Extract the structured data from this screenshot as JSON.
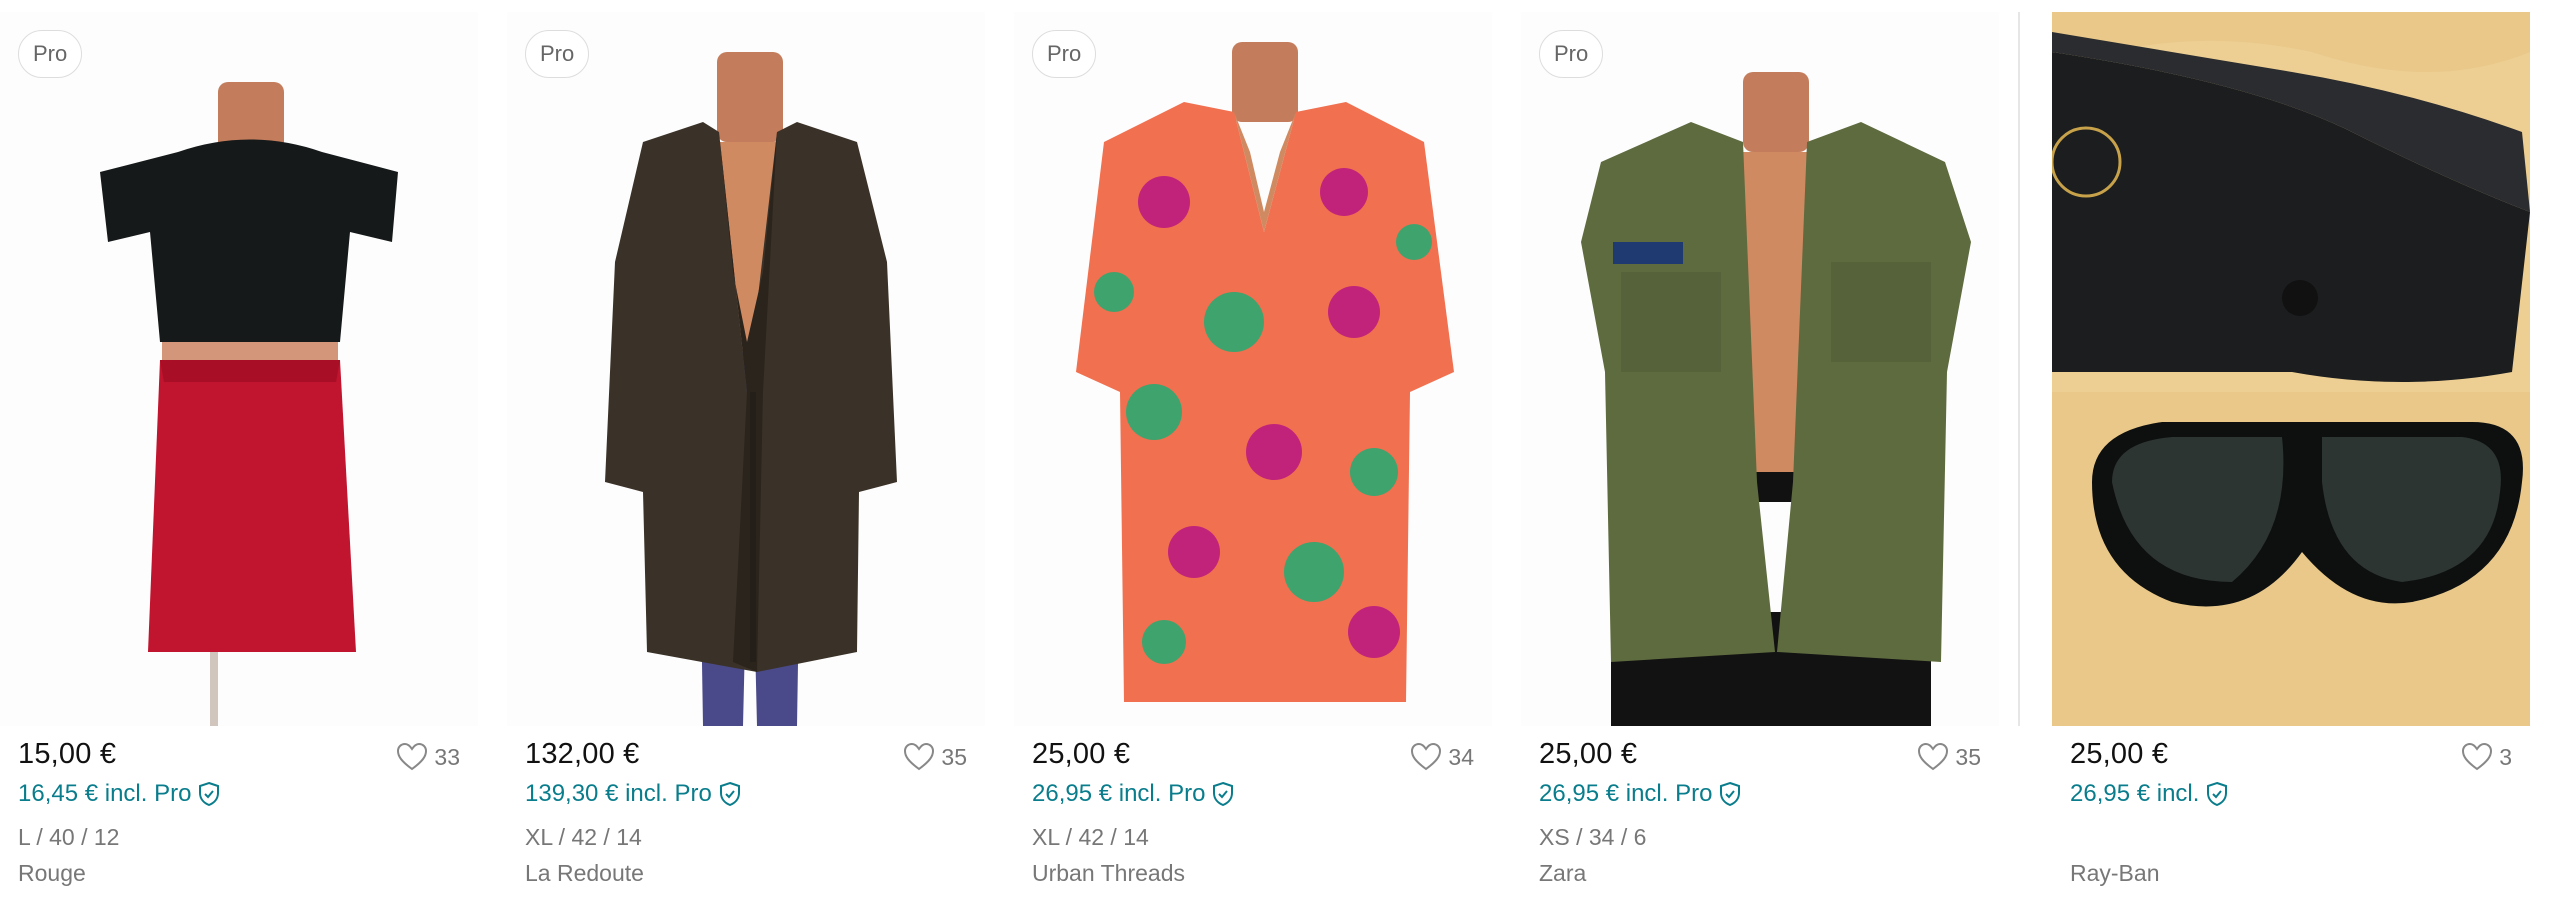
{
  "listings": [
    {
      "badge": "Pro",
      "price": "15,00 €",
      "pro_price": "16,45 € incl. Pro",
      "likes": "33",
      "size": "L / 40 / 12",
      "brand": "Rouge",
      "image": "mannequin-black-top-red-skirt"
    },
    {
      "badge": "Pro",
      "price": "132,00 €",
      "pro_price": "139,30 € incl. Pro",
      "likes": "35",
      "size": "XL / 42 / 14",
      "brand": "La Redoute",
      "image": "mannequin-brown-leather-coat"
    },
    {
      "badge": "Pro",
      "price": "25,00 €",
      "pro_price": "26,95 € incl. Pro",
      "likes": "34",
      "size": "XL / 42 / 14",
      "brand": "Urban Threads",
      "image": "mannequin-floral-shirt"
    },
    {
      "badge": "Pro",
      "price": "25,00 €",
      "pro_price": "26,95 € incl. Pro",
      "likes": "35",
      "size": "XS / 34 / 6",
      "brand": "Zara",
      "image": "mannequin-green-military-jacket"
    },
    {
      "badge": "",
      "price": "25,00 €",
      "pro_price": "26,95 € incl.",
      "likes": "3",
      "size": "",
      "brand": "Ray-Ban",
      "image": "sunglasses-and-case"
    }
  ],
  "colors": {
    "pro_accent": "#0a7d8c",
    "muted_text": "#777777",
    "price_text": "#111111"
  },
  "icons": [
    "heart-icon",
    "shield-check-icon"
  ]
}
